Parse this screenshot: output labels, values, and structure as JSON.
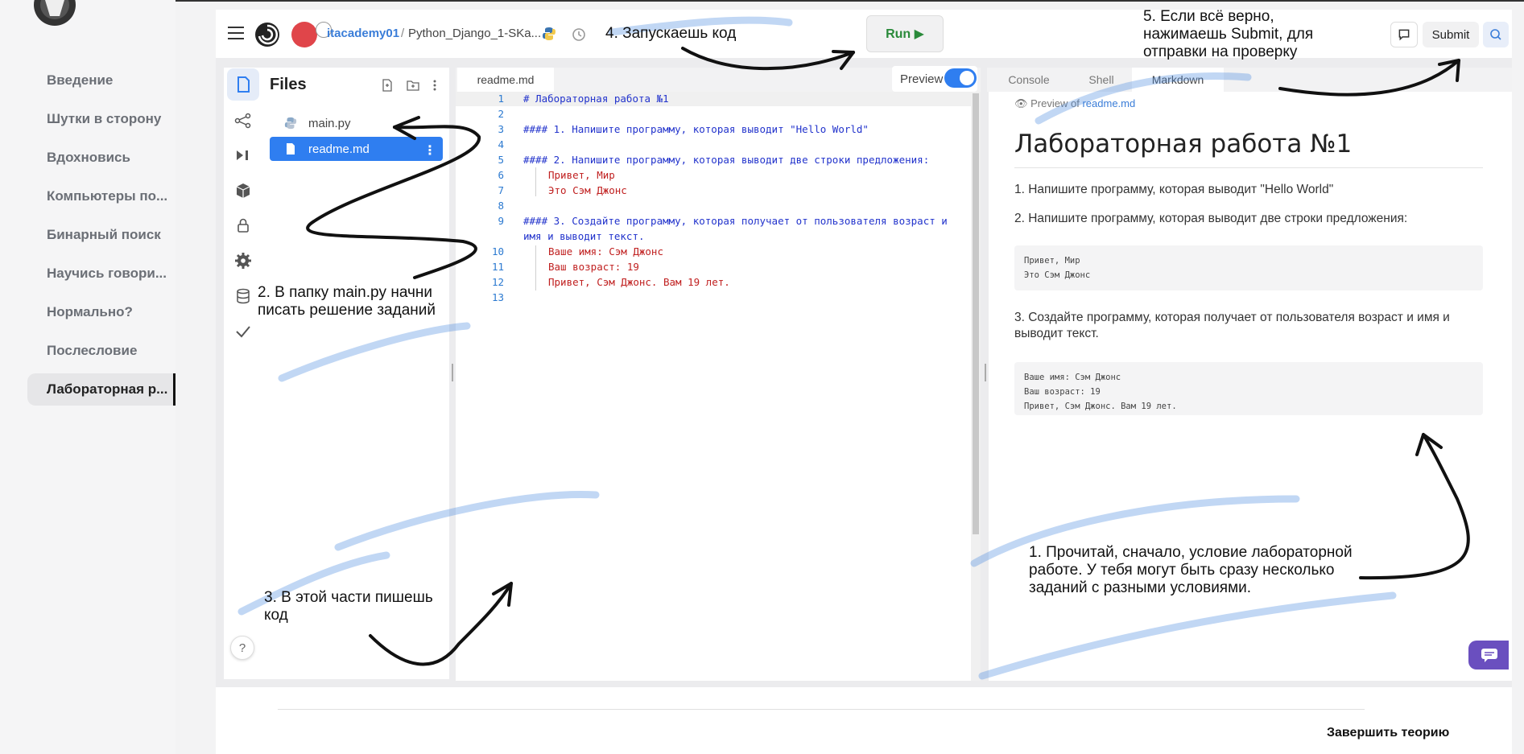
{
  "sidebar": {
    "lessons": [
      "Введение",
      "Шутки в сторону",
      "Вдохновись",
      "Компьютеры по...",
      "Бинарный поиск",
      "Научись говори...",
      "Нормально?",
      "Послесловие",
      "Лабораторная р..."
    ],
    "active_index": 8
  },
  "topbar": {
    "user": "itacademy01",
    "separator": "/",
    "repl_name": "Python_Django_1-SKa...",
    "run_label": "Run ▶",
    "submit_label": "Submit"
  },
  "files": {
    "title": "Files",
    "items": [
      "main.py",
      "readme.md"
    ],
    "selected": "readme.md",
    "help": "?"
  },
  "editor": {
    "tab": "readme.md",
    "preview_label": "Preview",
    "preview_on": true,
    "lines": [
      {
        "n": "1",
        "text": "# Лабораторная работа №1",
        "kind": "head"
      },
      {
        "n": "2",
        "text": "",
        "kind": "head"
      },
      {
        "n": "3",
        "text": "#### 1. Напишите программу, которая выводит \"Hello World\"",
        "kind": "head"
      },
      {
        "n": "4",
        "text": "",
        "kind": "head"
      },
      {
        "n": "5",
        "text": "#### 2. Напишите программу, которая выводит две строки предложения:",
        "kind": "head"
      },
      {
        "n": "6",
        "text": "Привет, Мир",
        "kind": "text"
      },
      {
        "n": "7",
        "text": "Это Сэм Джонс",
        "kind": "text"
      },
      {
        "n": "8",
        "text": "",
        "kind": "head"
      },
      {
        "n": "9",
        "text": "#### 3. Создайте программу, которая получает от пользователя возраст и",
        "kind": "head"
      },
      {
        "n": "",
        "text": "имя и выводит текст.",
        "kind": "head"
      },
      {
        "n": "10",
        "text": "Ваше имя: Сэм Джонс",
        "kind": "text"
      },
      {
        "n": "11",
        "text": "Ваш возраст: 19",
        "kind": "text"
      },
      {
        "n": "12",
        "text": "Привет, Сэм Джонс. Вам 19 лет.",
        "kind": "text"
      },
      {
        "n": "13",
        "text": "",
        "kind": "head"
      }
    ]
  },
  "right_panel": {
    "tabs": [
      "Console",
      "Shell",
      "Markdown"
    ],
    "active_tab": "Markdown",
    "preview_of_prefix": "Preview of",
    "preview_of_file": "readme.md",
    "h1": "Лабораторная работа №1",
    "p1": "1. Напишите программу, которая выводит \"Hello World\"",
    "p2": "2. Напишите программу, которая выводит две строки предложения:",
    "pre1": "Привет, Мир\nЭто Сэм Джонс",
    "p3": "3. Создайте программу, которая получает от пользователя возраст и имя и выводит текст.",
    "pre2": "Ваше имя: Сэм Джонс\nВаш возраст: 19\nПривет, Сэм Джонс. Вам 19 лет."
  },
  "footer": {
    "finish_label": "Завершить теорию"
  },
  "annotations": {
    "a1": "1. Прочитай, сначало, условие лабораторной работе. У тебя могут быть сразу несколько заданий с разными условиями.",
    "a2": "2. В папку main.py начни писать решение заданий",
    "a3": "3. В этой части пишешь код",
    "a4": "4. Запускаешь код",
    "a5": "5. Если всё верно, нажимаешь Submit, для отправки на проверку"
  },
  "colors": {
    "accent": "#2f7ef0",
    "run_green": "#2a8a3a",
    "code_heading": "#2233cc",
    "code_text": "#c02020",
    "chat_fab": "#6a4fbf"
  }
}
